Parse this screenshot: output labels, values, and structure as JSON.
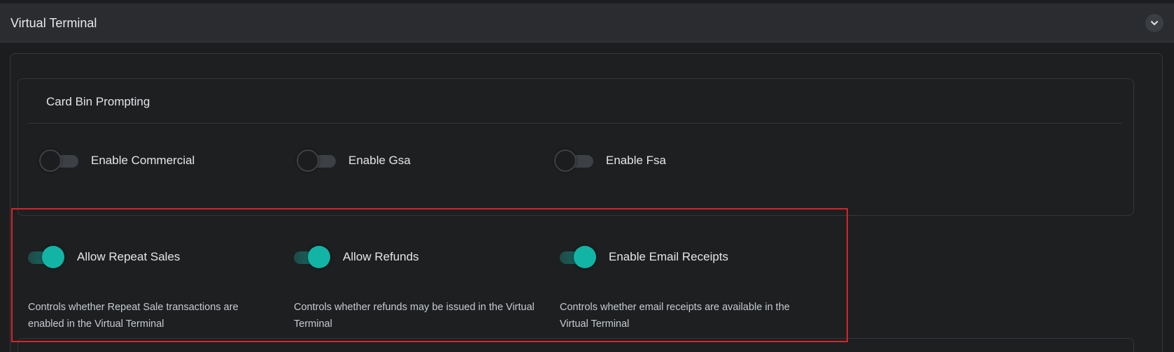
{
  "section": {
    "title": "Virtual Terminal",
    "collapse_icon": "chevron-down-icon"
  },
  "card_bin": {
    "title": "Card Bin Prompting",
    "toggles": [
      {
        "label": "Enable Commercial",
        "on": false
      },
      {
        "label": "Enable Gsa",
        "on": false
      },
      {
        "label": "Enable Fsa",
        "on": false
      }
    ]
  },
  "features": [
    {
      "label": "Allow Repeat Sales",
      "on": true,
      "description_line1": "Controls whether Repeat Sale transactions are",
      "description_line2": "enabled in the Virtual Terminal"
    },
    {
      "label": "Allow Refunds",
      "on": true,
      "description_line1": "Controls whether refunds may be issued in the Virtual",
      "description_line2": "Terminal"
    },
    {
      "label": "Enable Email Receipts",
      "on": true,
      "description_line1": "Controls whether email receipts are available in the",
      "description_line2": "Virtual Terminal"
    }
  ],
  "colors": {
    "accent": "#12b5a5",
    "highlight": "#d8232a",
    "background": "#1b1d1f",
    "header": "#2a2c2f"
  }
}
